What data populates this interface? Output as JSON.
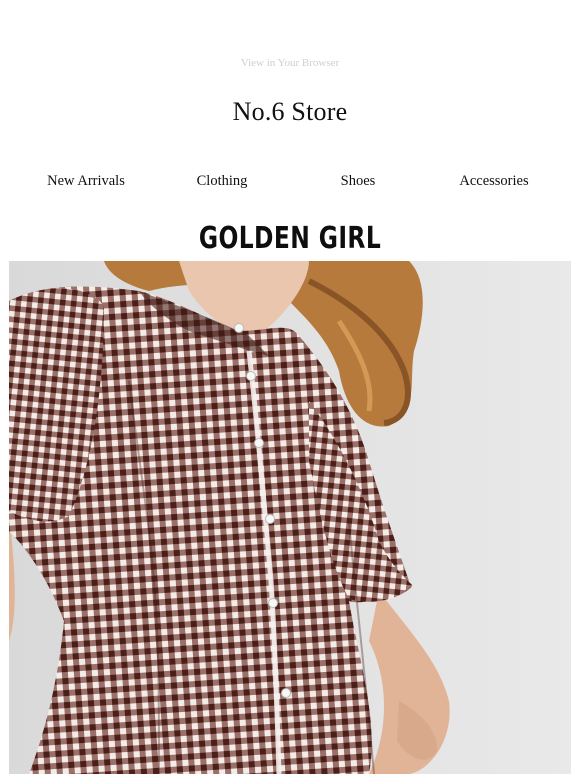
{
  "header": {
    "view_in_browser": "View in Your Browser",
    "store_name": "No.6 Store"
  },
  "nav": {
    "items": [
      "New Arrivals",
      "Clothing",
      "Shoes",
      "Accessories"
    ]
  },
  "banner": {
    "brand_title": "GOLDEN GIRL"
  },
  "colors": {
    "background": "#ffffff",
    "gingham_brown": "#5a2a22",
    "hero_background": "#e6e6e6",
    "hair": "#b57a3c"
  }
}
